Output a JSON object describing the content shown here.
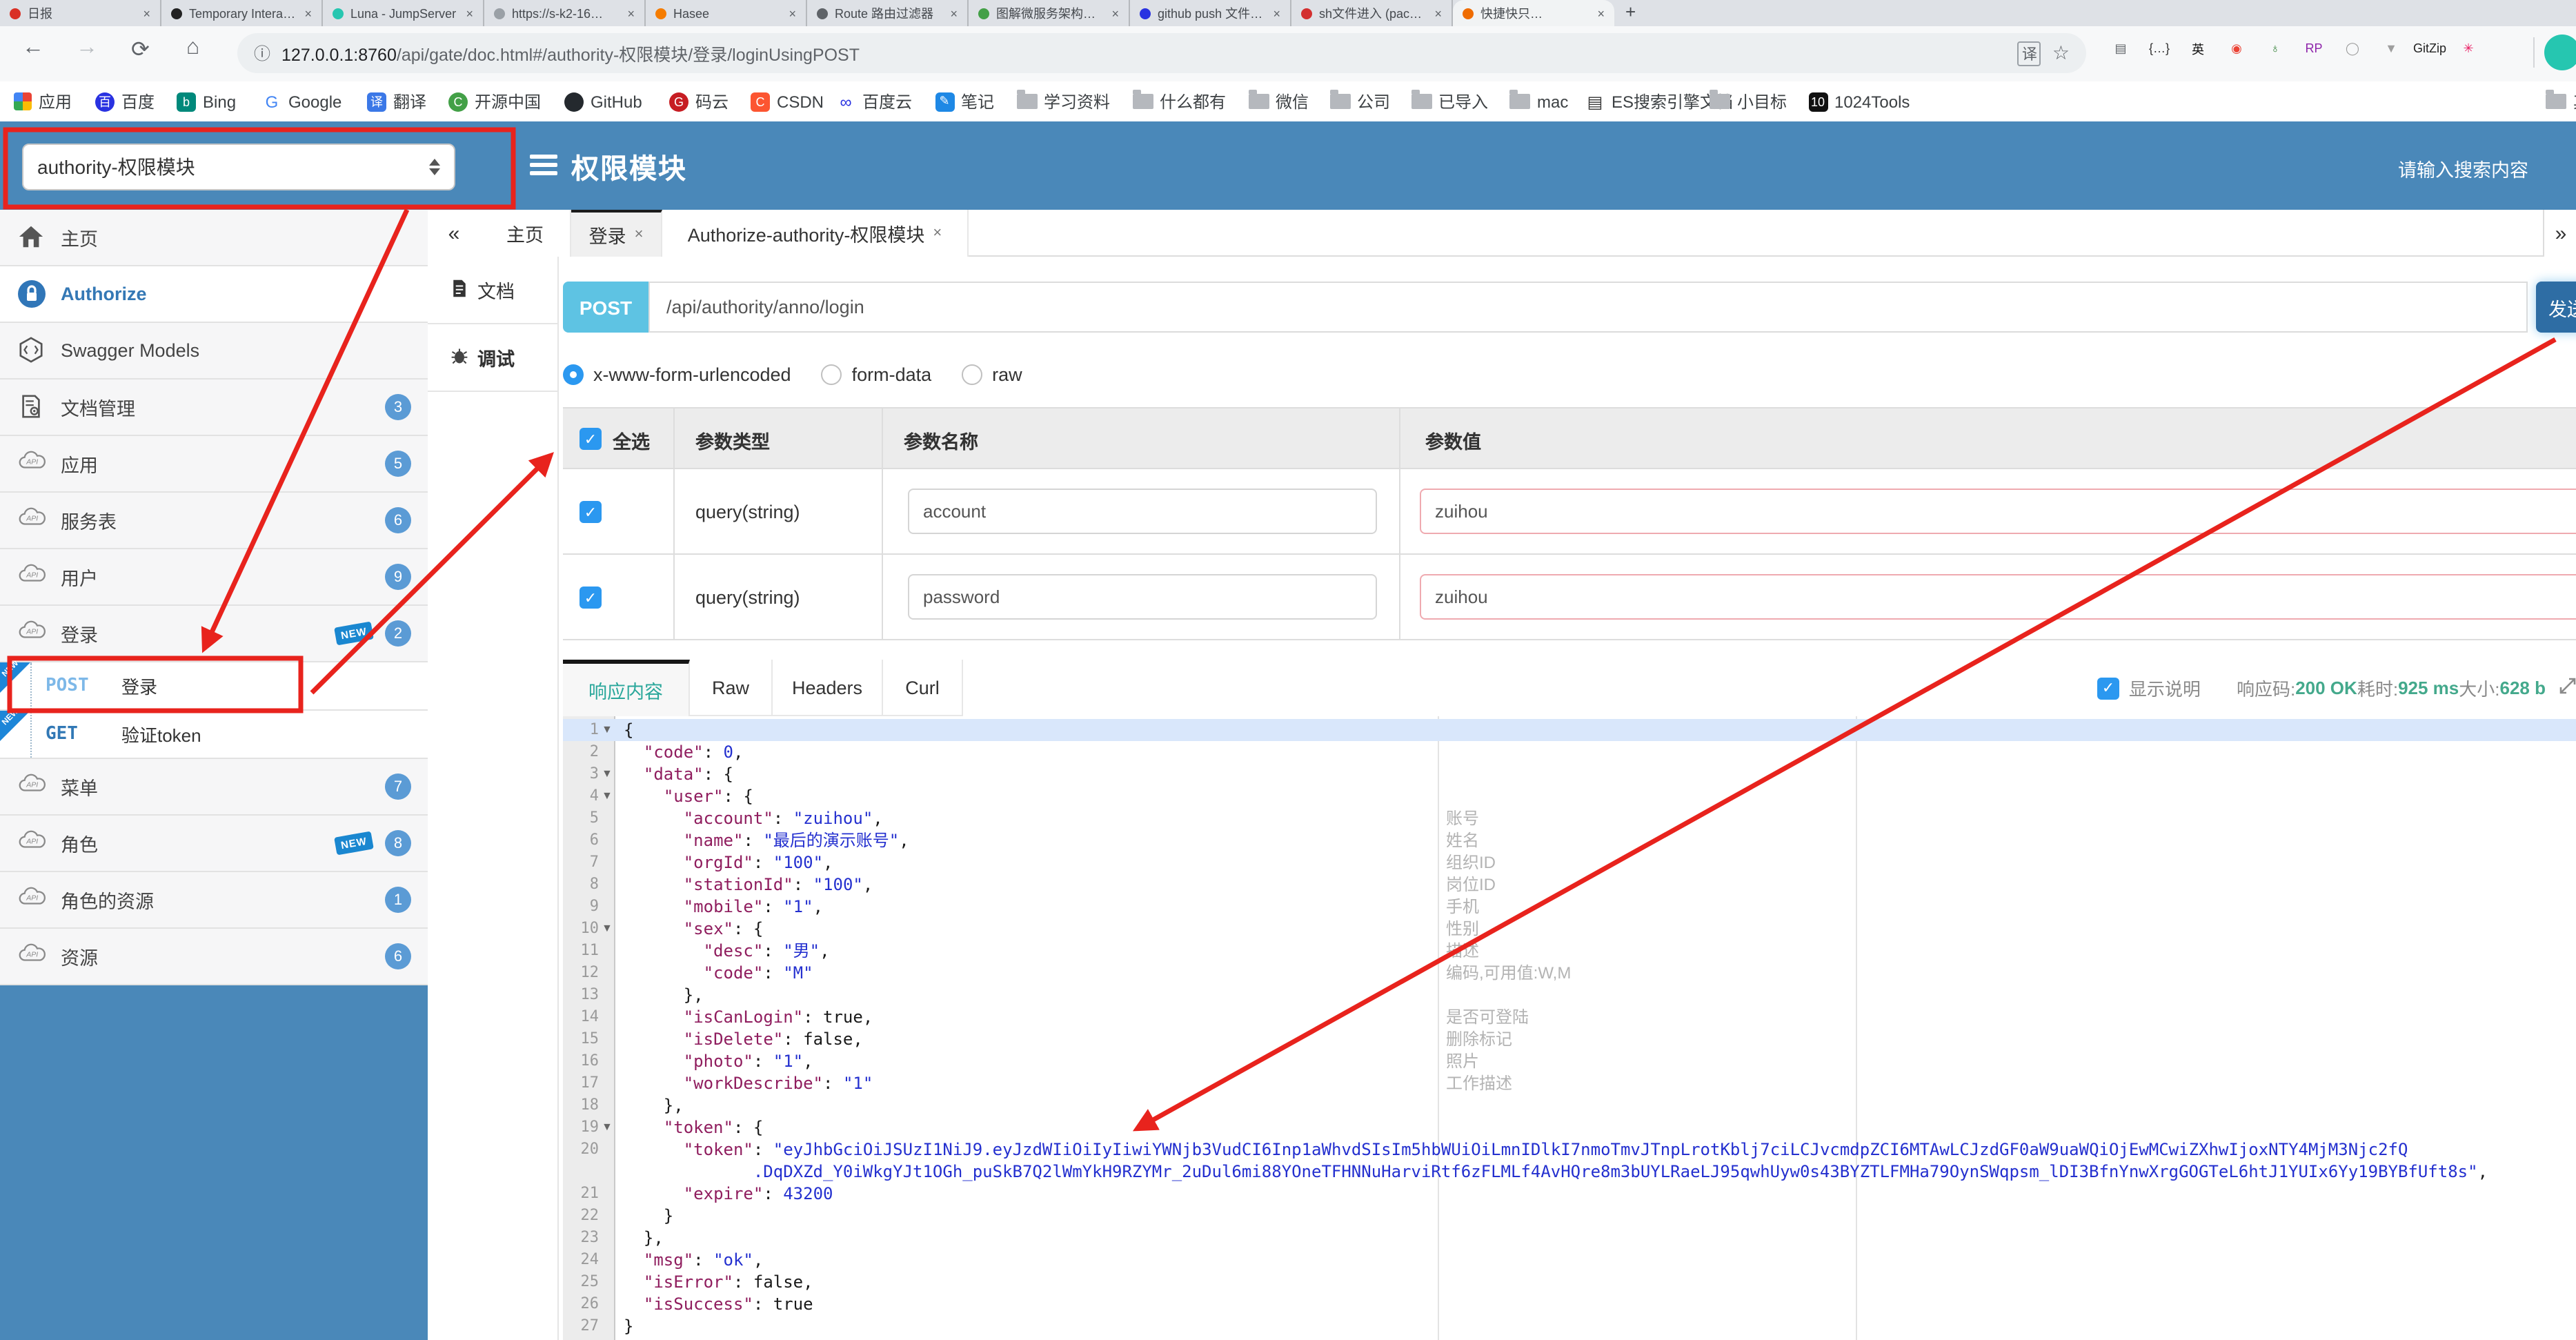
{
  "colors": {
    "accent_blue": "#4a88b9",
    "post_chip": "#5ec3e3",
    "send_btn": "#2e6da4",
    "badge": "#5b9bd5",
    "annotation_red": "#e8231d",
    "ok_green": "#44a98c",
    "active_tab_teal": "#2aa79b"
  },
  "browser": {
    "tabs": [
      {
        "title": "日报",
        "color": "#d93025"
      },
      {
        "title": "Temporary Interact…",
        "color": "#222222"
      },
      {
        "title": "Luna - JumpServer",
        "color": "#26c6b0"
      },
      {
        "title": "https://s-k2-16…",
        "color": "#9aa0a6"
      },
      {
        "title": "Hasee",
        "color": "#f57c00"
      },
      {
        "title": "Route 路由过滤器",
        "color": "#5f6368"
      },
      {
        "title": "图解微服务架构三…",
        "color": "#43a047"
      },
      {
        "title": "github push 文件夹…",
        "color": "#2932e1"
      },
      {
        "title": "sh文件进入 (pack…",
        "color": "#d32f2f"
      },
      {
        "title": "快捷快只…",
        "color": "#ef6c00",
        "active": true
      }
    ],
    "new_tab_glyph": "+",
    "close_glyph": "×",
    "nav": {
      "back": "←",
      "forward": "→",
      "reload": "⟳",
      "home": "⌂"
    },
    "url": {
      "info": "ⓘ",
      "host": "127.0.0.1:8760",
      "path": "/api/gate/doc.html#/authority-权限模块/登录/loginUsingPOST"
    },
    "pill": {
      "translate": "译",
      "star": "☆"
    },
    "extensions": [
      {
        "glyph": "▤",
        "color": "#5f6368"
      },
      {
        "glyph": "{…}",
        "color": "#333333"
      },
      {
        "glyph": "英",
        "color": "#111111"
      },
      {
        "glyph": "◉",
        "color": "#ea4335"
      },
      {
        "glyph": "♁",
        "color": "#2e7d32"
      },
      {
        "glyph": "RP",
        "color": "#8e24aa"
      },
      {
        "glyph": "◯",
        "color": "#9e9e9e"
      },
      {
        "glyph": "▼",
        "color": "#9e9e9e"
      },
      {
        "glyph": "GitZip",
        "color": "#222222"
      },
      {
        "glyph": "✳",
        "color": "#e91e63"
      }
    ],
    "bookmarks": [
      {
        "label": "应用",
        "fav": "grid"
      },
      {
        "label": "百度",
        "fav": "circle",
        "glyph": "百",
        "color": "#2932e1"
      },
      {
        "label": "Bing",
        "fav": "square",
        "glyph": "b",
        "color": "#00897b"
      },
      {
        "label": "Google",
        "fav": "letter",
        "glyph": "G",
        "color": "#4285f4"
      },
      {
        "label": "翻译",
        "fav": "square",
        "glyph": "译",
        "color": "#3b78e7"
      },
      {
        "label": "开源中国",
        "fav": "circle",
        "glyph": "C",
        "color": "#43a047"
      },
      {
        "label": "GitHub",
        "fav": "circle",
        "glyph": "",
        "color": "#24292e"
      },
      {
        "label": "码云",
        "fav": "circle",
        "glyph": "G",
        "color": "#c71d23"
      },
      {
        "label": "CSDN",
        "fav": "square",
        "glyph": "C",
        "color": "#fc5531"
      },
      {
        "label": "百度云",
        "fav": "letter",
        "glyph": "∞",
        "color": "#2932e1"
      },
      {
        "label": "笔记",
        "fav": "square",
        "glyph": "✎",
        "color": "#1e88e5"
      },
      {
        "label": "学习资料",
        "fav": "folder"
      },
      {
        "label": "什么都有",
        "fav": "folder"
      },
      {
        "label": "微信",
        "fav": "folder"
      },
      {
        "label": "公司",
        "fav": "folder"
      },
      {
        "label": "已导入",
        "fav": "folder"
      },
      {
        "label": "mac",
        "fav": "folder"
      },
      {
        "label": "ES搜索引擎文档",
        "fav": "letter",
        "glyph": "▤",
        "color": "#333333"
      },
      {
        "label": "小目标",
        "fav": "folder"
      },
      {
        "label": "1024Tools",
        "fav": "square",
        "glyph": "10",
        "color": "#111111"
      }
    ],
    "other_bookmark": "其"
  },
  "header": {
    "module_select": "authority-权限模块",
    "title": "权限模块",
    "search_placeholder": "请输入搜索内容"
  },
  "sidebar": {
    "items": [
      {
        "icon": "home",
        "label": "主页"
      },
      {
        "icon": "lock",
        "label": "Authorize",
        "style": "auth",
        "white": true
      },
      {
        "icon": "hexagon",
        "label": "Swagger Models"
      },
      {
        "icon": "docgear",
        "label": "文档管理",
        "badge": "3"
      },
      {
        "icon": "cloud",
        "label": "应用",
        "badge": "5"
      },
      {
        "icon": "cloud",
        "label": "服务表",
        "badge": "6"
      },
      {
        "icon": "cloud",
        "label": "用户",
        "badge": "9"
      },
      {
        "icon": "cloud",
        "label": "登录",
        "badge": "2",
        "new": true
      },
      {
        "op": true,
        "method": "POST",
        "label": "登录",
        "selected": true,
        "new": true
      },
      {
        "op": true,
        "method": "GET",
        "label": "验证token",
        "new": true
      },
      {
        "icon": "cloud",
        "label": "菜单",
        "badge": "7"
      },
      {
        "icon": "cloud",
        "label": "角色",
        "badge": "8",
        "new": true
      },
      {
        "icon": "cloud",
        "label": "角色的资源",
        "badge": "1"
      },
      {
        "icon": "cloud",
        "label": "资源",
        "badge": "6"
      }
    ],
    "new_label": "NEW"
  },
  "main_tabs": {
    "collapse_glyph": "«",
    "expand_glyph": "»",
    "close_glyph": "×",
    "tabs": [
      {
        "label": "主页",
        "closable": false
      },
      {
        "label": "登录",
        "closable": true,
        "active": true
      },
      {
        "label": "Authorize-authority-权限模块",
        "closable": true
      }
    ]
  },
  "panel_tabs": [
    {
      "icon": "doc",
      "label": "文档"
    },
    {
      "icon": "bug",
      "label": "调试",
      "active": true
    }
  ],
  "request": {
    "method": "POST",
    "path": "/api/authority/anno/login",
    "send_label": "发送",
    "body_types": [
      {
        "label": "x-www-form-urlencoded",
        "selected": true
      },
      {
        "label": "form-data",
        "selected": false
      },
      {
        "label": "raw",
        "selected": false
      }
    ]
  },
  "params": {
    "select_all": "全选",
    "headers": [
      "参数类型",
      "参数名称",
      "参数值"
    ],
    "rows": [
      {
        "checked": true,
        "type": "query(string)",
        "name": "account",
        "value": "zuihou"
      },
      {
        "checked": true,
        "type": "query(string)",
        "name": "password",
        "value": "zuihou"
      }
    ]
  },
  "response": {
    "tabs": [
      {
        "label": "响应内容",
        "active": true
      },
      {
        "label": "Raw"
      },
      {
        "label": "Headers"
      },
      {
        "label": "Curl"
      }
    ],
    "show_desc": "显示说明",
    "meta": [
      {
        "label": "响应码:",
        "value": "200 OK"
      },
      {
        "label": "耗时:",
        "value": "925 ms"
      },
      {
        "label": "大小:",
        "value": "628 b"
      }
    ]
  },
  "code": {
    "fold_lines": [
      1,
      3,
      4,
      10,
      19
    ],
    "lines": [
      {
        "n": 1,
        "t": [
          [
            "p",
            "{"
          ]
        ]
      },
      {
        "n": 2,
        "t": [
          [
            "p",
            "  "
          ],
          [
            "k",
            "\"code\""
          ],
          [
            "p",
            ": "
          ],
          [
            "num",
            "0"
          ],
          [
            "p",
            ","
          ]
        ]
      },
      {
        "n": 3,
        "t": [
          [
            "p",
            "  "
          ],
          [
            "k",
            "\"data\""
          ],
          [
            "p",
            ": {"
          ]
        ]
      },
      {
        "n": 4,
        "t": [
          [
            "p",
            "    "
          ],
          [
            "k",
            "\"user\""
          ],
          [
            "p",
            ": {"
          ]
        ]
      },
      {
        "n": 5,
        "t": [
          [
            "p",
            "      "
          ],
          [
            "k",
            "\"account\""
          ],
          [
            "p",
            ": "
          ],
          [
            "v",
            "\"zuihou\""
          ],
          [
            "p",
            ","
          ]
        ]
      },
      {
        "n": 6,
        "t": [
          [
            "p",
            "      "
          ],
          [
            "k",
            "\"name\""
          ],
          [
            "p",
            ": "
          ],
          [
            "v",
            "\"最后的演示账号\""
          ],
          [
            "p",
            ","
          ]
        ]
      },
      {
        "n": 7,
        "t": [
          [
            "p",
            "      "
          ],
          [
            "k",
            "\"orgId\""
          ],
          [
            "p",
            ": "
          ],
          [
            "v",
            "\"100\""
          ],
          [
            "p",
            ","
          ]
        ]
      },
      {
        "n": 8,
        "t": [
          [
            "p",
            "      "
          ],
          [
            "k",
            "\"stationId\""
          ],
          [
            "p",
            ": "
          ],
          [
            "v",
            "\"100\""
          ],
          [
            "p",
            ","
          ]
        ]
      },
      {
        "n": 9,
        "t": [
          [
            "p",
            "      "
          ],
          [
            "k",
            "\"mobile\""
          ],
          [
            "p",
            ": "
          ],
          [
            "v",
            "\"1\""
          ],
          [
            "p",
            ","
          ]
        ]
      },
      {
        "n": 10,
        "t": [
          [
            "p",
            "      "
          ],
          [
            "k",
            "\"sex\""
          ],
          [
            "p",
            ": {"
          ]
        ]
      },
      {
        "n": 11,
        "t": [
          [
            "p",
            "        "
          ],
          [
            "k",
            "\"desc\""
          ],
          [
            "p",
            ": "
          ],
          [
            "v",
            "\"男\""
          ],
          [
            "p",
            ","
          ]
        ]
      },
      {
        "n": 12,
        "t": [
          [
            "p",
            "        "
          ],
          [
            "k",
            "\"code\""
          ],
          [
            "p",
            ": "
          ],
          [
            "v",
            "\"M\""
          ]
        ]
      },
      {
        "n": 13,
        "t": [
          [
            "p",
            "      },"
          ]
        ]
      },
      {
        "n": 14,
        "t": [
          [
            "p",
            "      "
          ],
          [
            "k",
            "\"isCanLogin\""
          ],
          [
            "p",
            ": "
          ],
          [
            "b",
            "true"
          ],
          [
            "p",
            ","
          ]
        ]
      },
      {
        "n": 15,
        "t": [
          [
            "p",
            "      "
          ],
          [
            "k",
            "\"isDelete\""
          ],
          [
            "p",
            ": "
          ],
          [
            "b",
            "false"
          ],
          [
            "p",
            ","
          ]
        ]
      },
      {
        "n": 16,
        "t": [
          [
            "p",
            "      "
          ],
          [
            "k",
            "\"photo\""
          ],
          [
            "p",
            ": "
          ],
          [
            "v",
            "\"1\""
          ],
          [
            "p",
            ","
          ]
        ]
      },
      {
        "n": 17,
        "t": [
          [
            "p",
            "      "
          ],
          [
            "k",
            "\"workDescribe\""
          ],
          [
            "p",
            ": "
          ],
          [
            "v",
            "\"1\""
          ]
        ]
      },
      {
        "n": 18,
        "t": [
          [
            "p",
            "    },"
          ]
        ]
      },
      {
        "n": 19,
        "t": [
          [
            "p",
            "    "
          ],
          [
            "k",
            "\"token\""
          ],
          [
            "p",
            ": {"
          ]
        ]
      },
      {
        "n": 20,
        "t": [
          [
            "p",
            "      "
          ],
          [
            "k",
            "\"token\""
          ],
          [
            "p",
            ": "
          ],
          [
            "v",
            "\"eyJhbGciOiJSUzI1NiJ9.eyJzdWIiOiIyIiwiYWNjb3VudCI6Inp1aWhvdSIsIm5hbWUiOiLmnIDlkI7nmoTmvJTnpLrotKblj7ciLCJvcmdpZCI6MTAwLCJzdGF0aW9uaWQiOjEwMCwiZXhwIjoxNTY4MjM3Njc2fQ\n             .DqDXZd_Y0iWkgYJt1OGh_puSkB7Q2lWmYkH9RZYMr_2uDul6mi88YOneTFHNNuHarviRtf6zFLMLf4AvHQre8m3bUYLRaeLJ95qwhUyw0s43BYZTLFMHa79OynSWqpsm_lDI3BfnYnwXrgGOGTeL6htJ1YUIx6Yy19BYBfUft8s\""
          ],
          [
            "p",
            ","
          ]
        ]
      },
      {
        "n": 21,
        "t": [
          [
            "p",
            "      "
          ],
          [
            "k",
            "\"expire\""
          ],
          [
            "p",
            ": "
          ],
          [
            "num",
            "43200"
          ]
        ]
      },
      {
        "n": 22,
        "t": [
          [
            "p",
            "    }"
          ]
        ]
      },
      {
        "n": 23,
        "t": [
          [
            "p",
            "  },"
          ]
        ]
      },
      {
        "n": 24,
        "t": [
          [
            "p",
            "  "
          ],
          [
            "k",
            "\"msg\""
          ],
          [
            "p",
            ": "
          ],
          [
            "v",
            "\"ok\""
          ],
          [
            "p",
            ","
          ]
        ]
      },
      {
        "n": 25,
        "t": [
          [
            "p",
            "  "
          ],
          [
            "k",
            "\"isError\""
          ],
          [
            "p",
            ": "
          ],
          [
            "b",
            "false"
          ],
          [
            "p",
            ","
          ]
        ]
      },
      {
        "n": 26,
        "t": [
          [
            "p",
            "  "
          ],
          [
            "k",
            "\"isSuccess\""
          ],
          [
            "p",
            ": "
          ],
          [
            "b",
            "true"
          ]
        ]
      },
      {
        "n": 27,
        "t": [
          [
            "p",
            "}"
          ]
        ]
      }
    ],
    "descriptions": {
      "5": "账号",
      "6": "姓名",
      "7": "组织ID",
      "8": "岗位ID",
      "9": "手机",
      "10": "性别",
      "11": "描述",
      "12": "编码,可用值:W,M",
      "14": "是否可登陆",
      "15": "删除标记",
      "16": "照片",
      "17": "工作描述"
    }
  }
}
